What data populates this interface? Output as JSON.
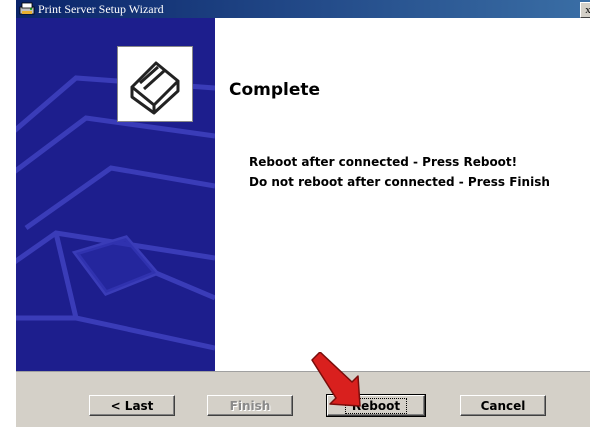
{
  "window": {
    "title": "Print Server Setup Wizard",
    "close_glyph": "x"
  },
  "page": {
    "heading": "Complete",
    "line1": "Reboot after connected - Press Reboot!",
    "line2": "Do not reboot after connected - Press Finish"
  },
  "buttons": {
    "last": "< Last",
    "finish": "Finish",
    "reboot": "Reboot",
    "cancel": "Cancel"
  },
  "colors": {
    "sidebar": "#1d1e8d",
    "titlebar": "#0a246a",
    "arrow": "#d9201e"
  },
  "icons": {
    "app": "printer-wizard-icon",
    "logo": "printer-icon",
    "annotation": "red-arrow"
  }
}
